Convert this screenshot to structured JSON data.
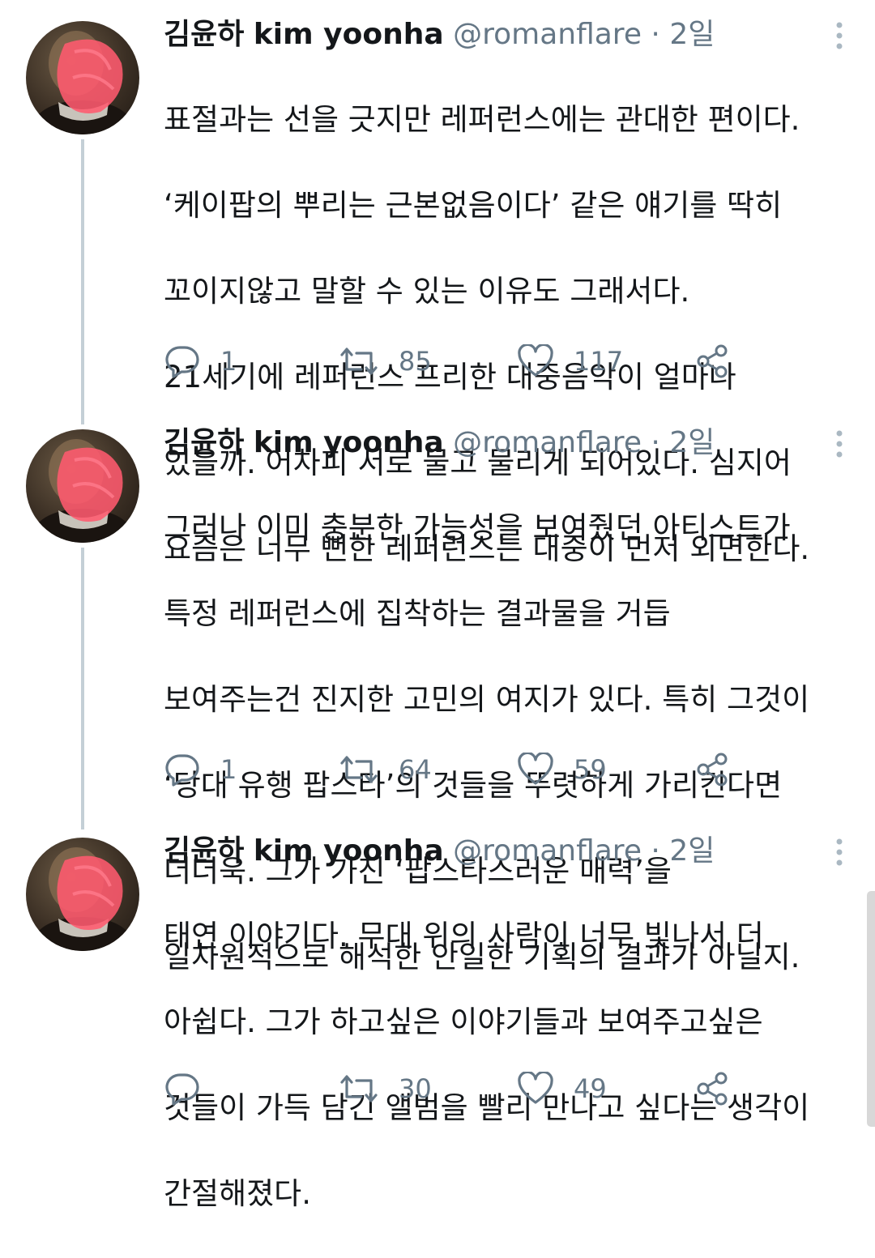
{
  "tweets": [
    {
      "name_ko": "김윤하",
      "name_en": "kim yoonha",
      "handle": "@romanflare",
      "separator": "·",
      "time": "2일",
      "lines": [
        "표절과는 선을 긋지만 레퍼런스에는 관대한 편이다.",
        "‘케이팝의 뿌리는 근본없음이다’ 같은 얘기를 딱히",
        "꼬이지않고 말할 수 있는 이유도 그래서다.",
        "21세기에 레퍼런스 프리한 대중음악이 얼마나",
        "있을까. 어차피 서로 물고 물리게 되어있다. 심지어",
        "요즘은 너무 뻔한 레퍼런스는 대중이 먼저 외면한다."
      ],
      "replies": "1",
      "retweets": "85",
      "likes": "117"
    },
    {
      "name_ko": "김윤하",
      "name_en": "kim yoonha",
      "handle": "@romanflare",
      "separator": "·",
      "time": "2일",
      "lines": [
        "그러나 이미 충분한 가능성을 보여줬던 아티스트가",
        "특정 레퍼런스에 집착하는 결과물을 거듭",
        "보여주는건 진지한 고민의 여지가 있다. 특히 그것이",
        "‘당대 유행 팝스타’의 것들을 뚜렷하게 가리킨다면",
        "더더욱. 그가 가진 ‘팝스타스러운 매력’을",
        "일차원적으로 해석한 안일한 기획의 결과가 아닐지."
      ],
      "replies": "1",
      "retweets": "64",
      "likes": "59"
    },
    {
      "name_ko": "김윤하",
      "name_en": "kim yoonha",
      "handle": "@romanflare",
      "separator": "·",
      "time": "2일",
      "lines": [
        "태연 이야기다. 무대 위의 사람이 너무 빛나서 더",
        "아쉽다. 그가 하고싶은 이야기들과 보여주고싶은",
        "것들이 가득 담긴 앨범을 빨리 만나고 싶다는 생각이",
        "간절해졌다."
      ],
      "replies": "",
      "retweets": "30",
      "likes": "49"
    }
  ],
  "icons": {
    "reply": "reply-icon",
    "retweet": "retweet-icon",
    "like": "like-icon",
    "share": "share-icon",
    "more": "more-vertical-icon"
  },
  "colors": {
    "text": "#14171a",
    "secondary": "#657786",
    "thread_line": "#c4cfd6",
    "avatar_overlay": "#ff5a6e"
  }
}
